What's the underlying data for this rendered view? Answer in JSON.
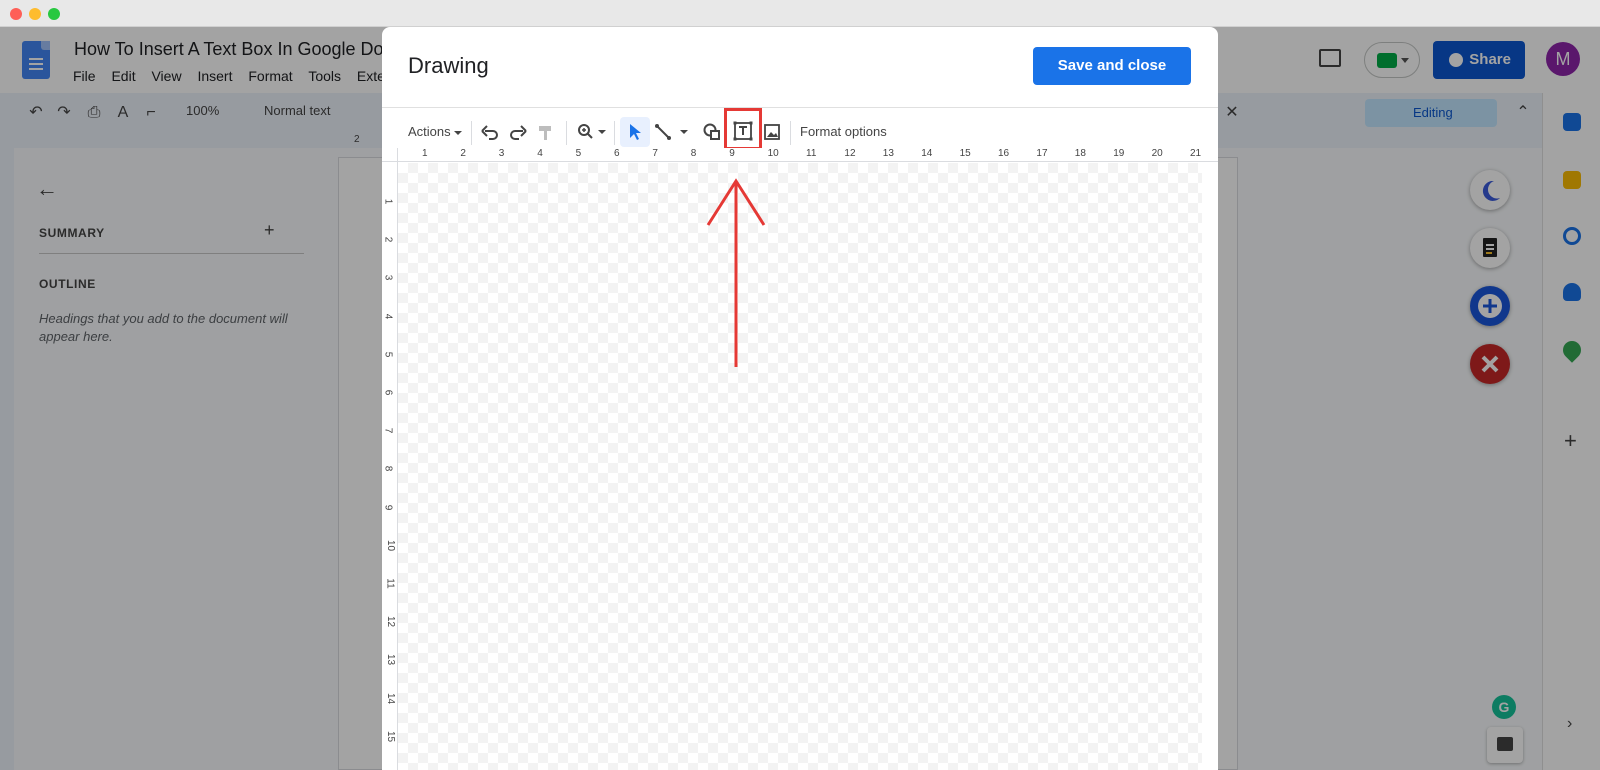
{
  "window": {
    "controls": [
      "close",
      "minimize",
      "zoom"
    ]
  },
  "docs": {
    "title": "How To Insert A Text Box In Google Docs",
    "menu": [
      "File",
      "Edit",
      "View",
      "Insert",
      "Format",
      "Tools",
      "Extensions"
    ],
    "share_label": "Share",
    "avatar_initial": "M",
    "toolbar": {
      "zoom": "100%",
      "style": "Normal text",
      "mode": "Editing"
    },
    "ruler_top_visible": "2",
    "outline": {
      "summary_label": "SUMMARY",
      "outline_label": "OUTLINE",
      "hint": "Headings that you add to the document will appear here."
    }
  },
  "drawing": {
    "title": "Drawing",
    "save_label": "Save and close",
    "actions_label": "Actions",
    "format_options_label": "Format options",
    "highlighted_tool": "text-box",
    "ruler_x": [
      "1",
      "2",
      "3",
      "4",
      "5",
      "6",
      "7",
      "8",
      "9",
      "10",
      "11",
      "12",
      "13",
      "14",
      "15",
      "16",
      "17",
      "18",
      "19",
      "20",
      "21"
    ],
    "ruler_y": [
      "1",
      "2",
      "3",
      "4",
      "5",
      "6",
      "7",
      "8",
      "9",
      "10",
      "11",
      "12",
      "13",
      "14",
      "15"
    ]
  },
  "colors": {
    "primary_blue": "#1a73e8",
    "highlight_red": "#e53935",
    "overlay": "rgba(0,0,0,0.36)"
  }
}
